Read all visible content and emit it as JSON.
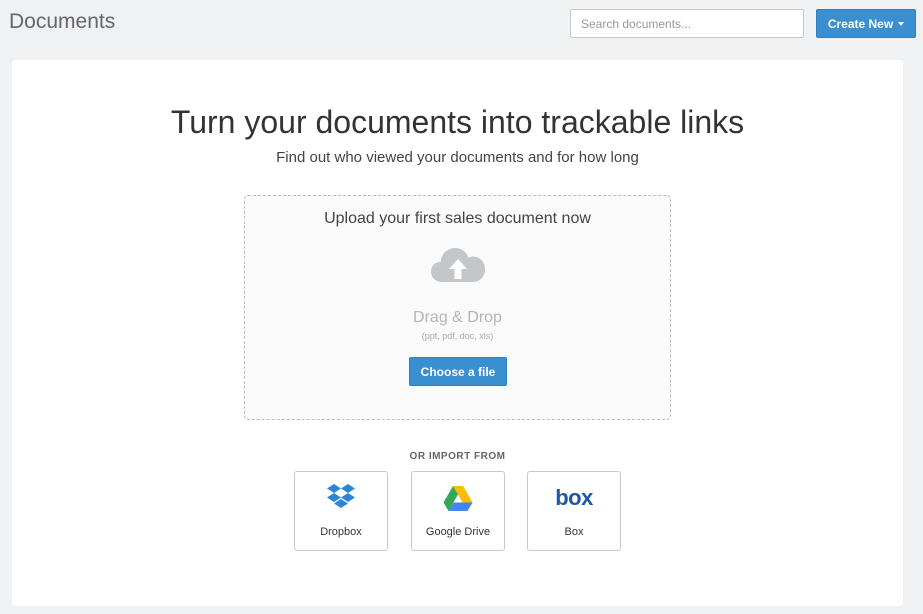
{
  "header": {
    "title": "Documents",
    "search_placeholder": "Search documents...",
    "create_new_label": "Create New"
  },
  "hero": {
    "title": "Turn your documents into trackable links",
    "subtitle": "Find out who viewed your documents and for how long"
  },
  "upload": {
    "title": "Upload your first sales document now",
    "drag_drop_label": "Drag & Drop",
    "formats_label": "(ppt, pdf, doc, xls)",
    "choose_file_label": "Choose a file"
  },
  "import": {
    "heading": "OR IMPORT FROM",
    "sources": [
      {
        "label": "Dropbox",
        "icon": "dropbox-icon"
      },
      {
        "label": "Google Drive",
        "icon": "google-drive-icon"
      },
      {
        "label": "Box",
        "icon": "box-icon",
        "logo_text": "box"
      }
    ]
  },
  "colors": {
    "accent": "#3a8fd0",
    "page_background": "#f0f1f3",
    "cloud_icon": "#c3c7ca",
    "dropbox_blue": "#2b86d9",
    "box_blue": "#1a5aa5"
  }
}
